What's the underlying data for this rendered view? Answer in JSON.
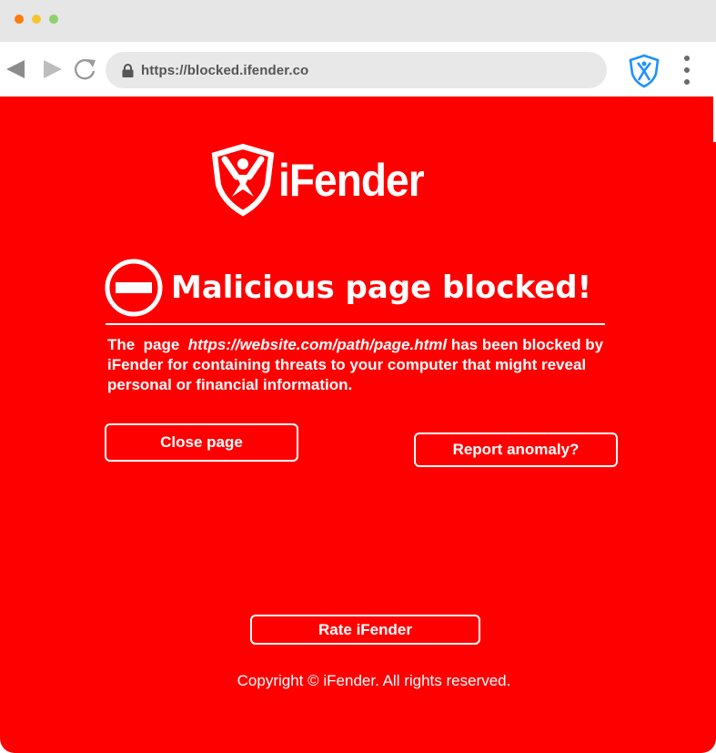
{
  "window": {
    "controls": [
      "close-dot",
      "minimize-dot",
      "maximize-dot"
    ]
  },
  "toolbar": {
    "url": "https://blocked.ifender.co",
    "icons": [
      "back-arrow-icon",
      "forward-arrow-icon",
      "reload-icon",
      "lock-icon",
      "ifender-extension-icon",
      "kebab-menu-icon"
    ]
  },
  "page": {
    "brand_name": "iFender",
    "heading": "Malicious page blocked!",
    "message_prefix": "The  page  ",
    "blocked_url": "https://website.com/path/page.html",
    "message_suffix": " has been blocked by iFender for containing threats to your computer that might reveal personal or financial information.",
    "close_button": "Close page",
    "report_button": "Report anomaly?",
    "rate_button": "Rate iFender",
    "copyright": "Copyright © iFender. All rights reserved."
  },
  "colors": {
    "background": "#ff0000",
    "text": "#ffffff",
    "titlebar": "#e6e6e6",
    "urlbar": "#e8e8e8",
    "extension_blue": "#1e90ff"
  }
}
